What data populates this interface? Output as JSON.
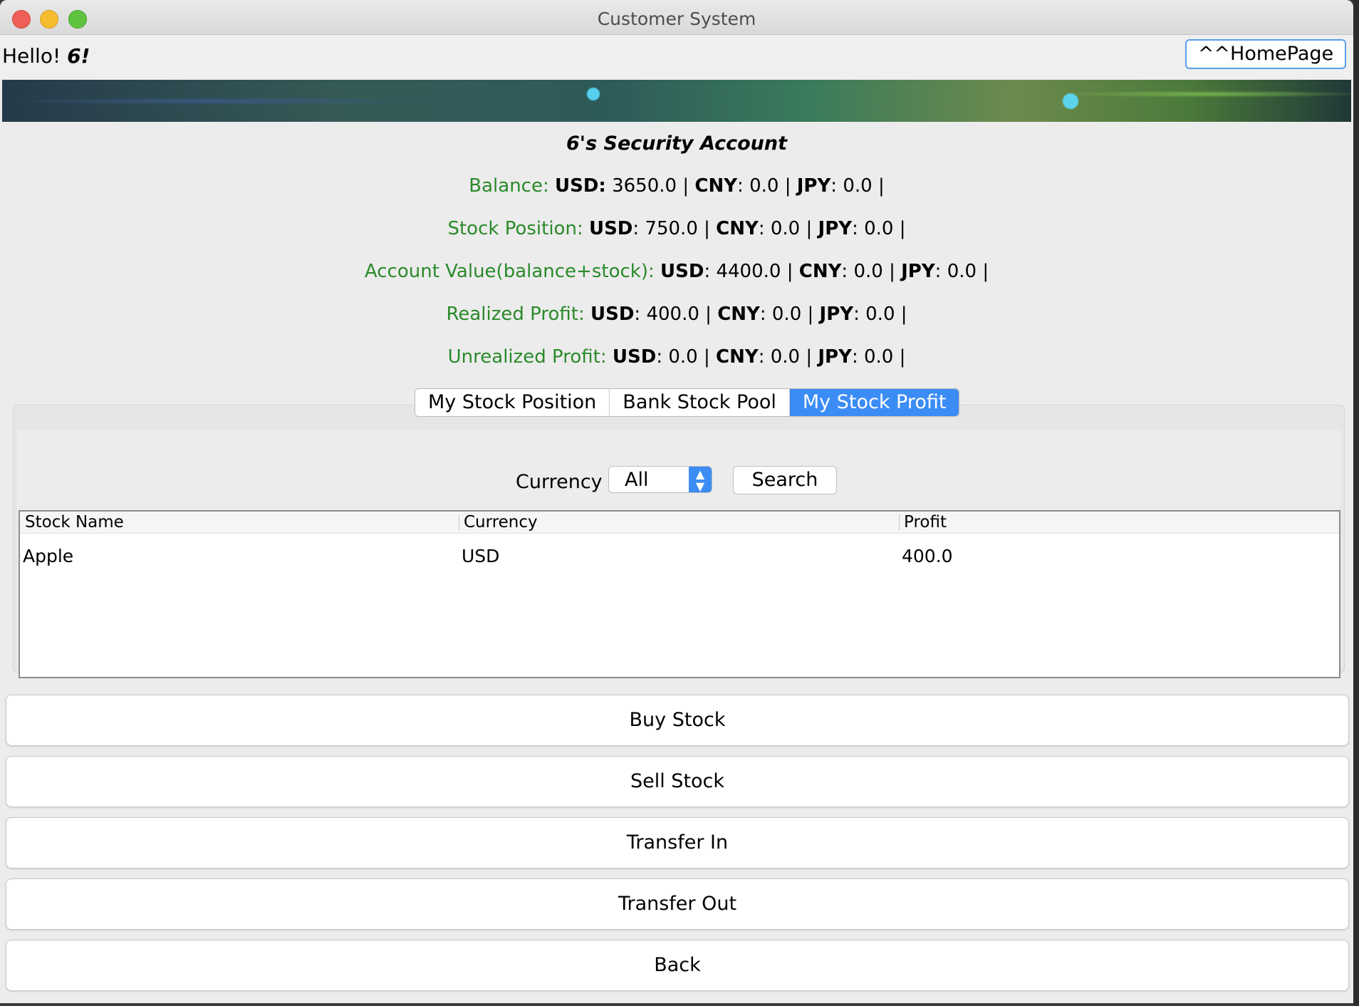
{
  "window": {
    "title": "Customer System"
  },
  "header": {
    "hello_prefix": "Hello!",
    "username": "6!",
    "home_button": "^^HomePage"
  },
  "account": {
    "title": "6's Security Account",
    "lines": [
      {
        "label": "Balance:",
        "values": [
          {
            "cur": "USD:",
            "amt": "3650.0"
          },
          {
            "cur": "CNY",
            "amt": "0.0"
          },
          {
            "cur": "JPY",
            "amt": "0.0"
          }
        ]
      },
      {
        "label": "Stock Position:",
        "values": [
          {
            "cur": "USD",
            "amt": "750.0"
          },
          {
            "cur": "CNY",
            "amt": "0.0"
          },
          {
            "cur": "JPY",
            "amt": "0.0"
          }
        ]
      },
      {
        "label": "Account Value(balance+stock):",
        "values": [
          {
            "cur": "USD",
            "amt": "4400.0"
          },
          {
            "cur": "CNY",
            "amt": "0.0"
          },
          {
            "cur": "JPY",
            "amt": "0.0"
          }
        ]
      },
      {
        "label": "Realized Profit:",
        "values": [
          {
            "cur": "USD",
            "amt": "400.0"
          },
          {
            "cur": "CNY",
            "amt": "0.0"
          },
          {
            "cur": "JPY",
            "amt": "0.0"
          }
        ]
      },
      {
        "label": "Unrealized Profit:",
        "values": [
          {
            "cur": "USD",
            "amt": "0.0"
          },
          {
            "cur": "CNY",
            "amt": "0.0"
          },
          {
            "cur": "JPY",
            "amt": "0.0"
          }
        ]
      }
    ]
  },
  "tabs": [
    {
      "label": "My Stock Position",
      "active": false
    },
    {
      "label": "Bank Stock Pool",
      "active": false
    },
    {
      "label": "My Stock Profit",
      "active": true
    }
  ],
  "filter": {
    "label": "Currency",
    "selected": "All",
    "search_button": "Search"
  },
  "table": {
    "columns": [
      "Stock Name",
      "Currency",
      "Profit"
    ],
    "rows": [
      [
        "Apple",
        "USD",
        "400.0"
      ]
    ]
  },
  "actions": [
    "Buy Stock",
    "Sell Stock",
    "Transfer In",
    "Transfer Out",
    "Back"
  ],
  "colors": {
    "label_green": "#2a8a2a",
    "accent_blue": "#3b8cf5"
  }
}
